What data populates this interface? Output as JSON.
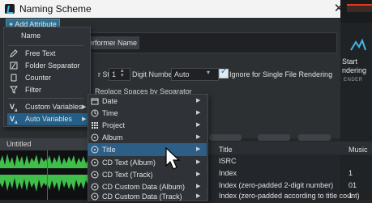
{
  "window": {
    "title": "Naming Scheme",
    "close": "✕"
  },
  "toolbar": {
    "add_attribute": "Add Attribute"
  },
  "scheme": {
    "chips": [
      "erformer",
      "Name"
    ]
  },
  "options": {
    "start_label": "r Start",
    "start_value": "1",
    "digit_label": "Digit Number",
    "digit_value": "Auto",
    "ignore_label": "Ignore for Single File Rendering",
    "ignore_checked": true,
    "replace_label": "Replace Spaces by Separator"
  },
  "right_panel": {
    "start": "Start",
    "rendering": "ndering",
    "section": "ENDER"
  },
  "lower": {
    "untitled": "Untitled"
  },
  "menu1": {
    "items": [
      {
        "label": "Name",
        "icon": "none"
      },
      {
        "label": "Free Text",
        "icon": "pencil-icon"
      },
      {
        "label": "Folder Separator",
        "icon": "folder-icon"
      },
      {
        "label": "Counter",
        "icon": "counter-icon"
      },
      {
        "label": "Filter",
        "icon": "filter-icon"
      },
      {
        "label": "Custom Variables",
        "icon": "variable-icon",
        "arrow": "▶"
      },
      {
        "label": "Auto Variables",
        "icon": "variable-icon",
        "arrow": "▶",
        "highlighted": true
      }
    ]
  },
  "menu2": {
    "items": [
      {
        "label": "Date",
        "icon": "calendar-icon",
        "arrow": "▶"
      },
      {
        "label": "Time",
        "icon": "clock-icon",
        "arrow": "▶"
      },
      {
        "label": "Project",
        "icon": "grid-icon",
        "arrow": "▶"
      },
      {
        "label": "Album",
        "icon": "disc-icon",
        "arrow": "▶"
      },
      {
        "label": "Title",
        "icon": "disc-icon",
        "arrow": "▶",
        "highlighted": true
      },
      {
        "label": "CD Text (Album)",
        "icon": "disc-icon",
        "arrow": "▶"
      },
      {
        "label": "CD Text (Track)",
        "icon": "disc-icon",
        "arrow": "▶"
      },
      {
        "label": "CD Custom Data (Album)",
        "icon": "disc-icon",
        "arrow": "▶"
      },
      {
        "label": "CD Custom Data (Track)",
        "icon": "disc-icon",
        "arrow": "▶"
      }
    ]
  },
  "submenu_rows": [
    {
      "label": "Title",
      "value": "Music"
    },
    {
      "label": "ISRC",
      "value": ""
    },
    {
      "label": "Index",
      "value": "1"
    },
    {
      "label": "Index (zero-padded 2-digit number)",
      "value": "01"
    },
    {
      "label": "Index (zero-padded according to title count)",
      "value": "1"
    }
  ],
  "colors": {
    "accent": "#235f86",
    "highlight": "#2c5e86",
    "waveform": "#3fbf4a"
  }
}
